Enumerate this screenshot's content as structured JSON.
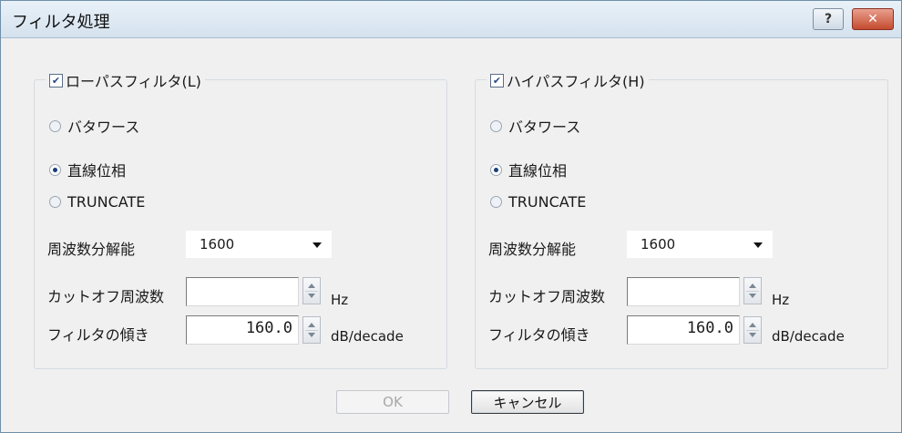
{
  "window": {
    "title": "フィルタ処理",
    "help_symbol": "?",
    "close_symbol": "✕"
  },
  "lowpass": {
    "label": "ローパスフィルタ(L)",
    "checked": true,
    "radio_butterworth": "バタワース",
    "radio_linear_phase": "直線位相",
    "radio_truncate": "TRUNCATE",
    "selected_radio": "直線位相",
    "freq_resolution_label": "周波数分解能",
    "freq_resolution_value": "1600",
    "cutoff_label": "カットオフ周波数",
    "cutoff_value": "",
    "cutoff_unit": "Hz",
    "slope_label": "フィルタの傾き",
    "slope_value": "160.0",
    "slope_unit": "dB/decade"
  },
  "highpass": {
    "label": "ハイパスフィルタ(H)",
    "checked": true,
    "radio_butterworth": "バタワース",
    "radio_linear_phase": "直線位相",
    "radio_truncate": "TRUNCATE",
    "selected_radio": "直線位相",
    "freq_resolution_label": "周波数分解能",
    "freq_resolution_value": "1600",
    "cutoff_label": "カットオフ周波数",
    "cutoff_value": "",
    "cutoff_unit": "Hz",
    "slope_label": "フィルタの傾き",
    "slope_value": "160.0",
    "slope_unit": "dB/decade"
  },
  "buttons": {
    "ok": "OK",
    "cancel": "キャンセル"
  },
  "icons": {
    "check": "check-icon",
    "dropdown": "chevron-down-icon",
    "spin": "spin-arrows-icon"
  },
  "colors": {
    "title_bar": "#dce8f3",
    "close_button": "#c9553a",
    "selected_radio": "#1a3d7a"
  }
}
